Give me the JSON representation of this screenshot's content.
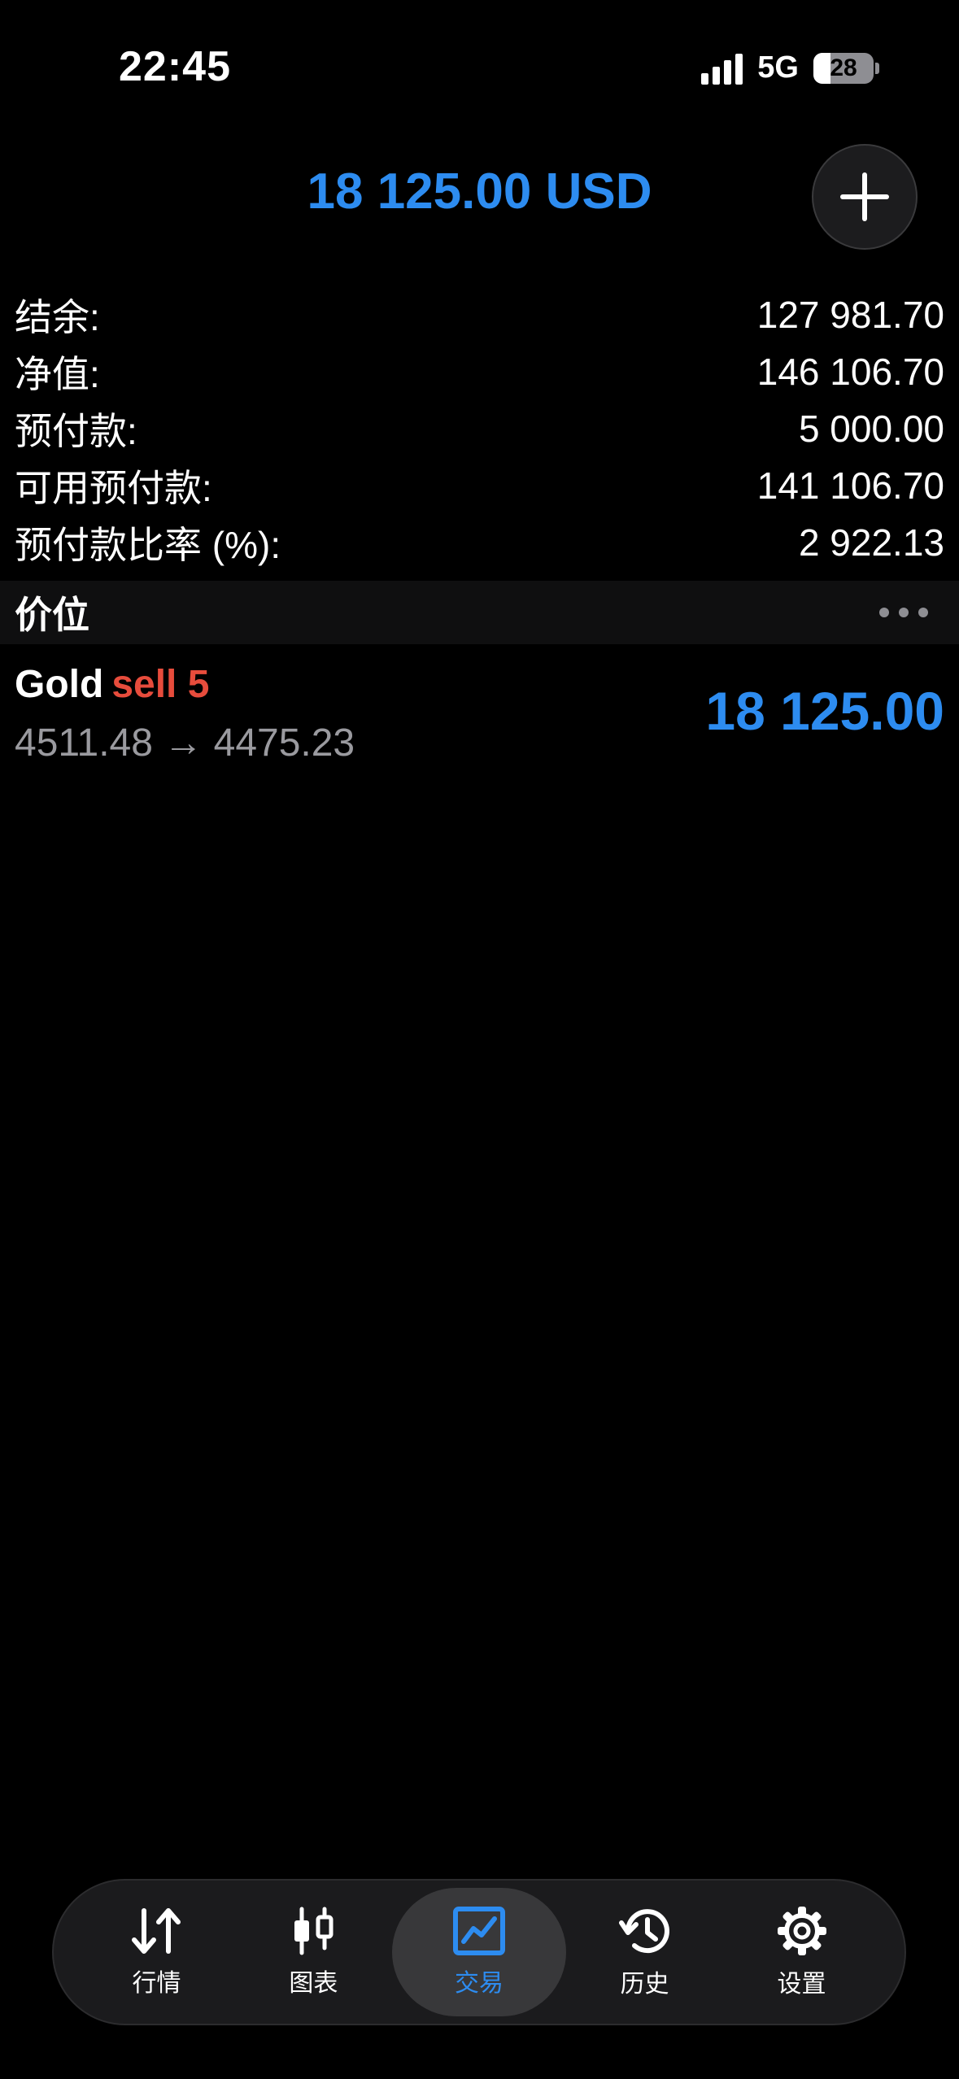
{
  "status_bar": {
    "time": "22:45",
    "network": "5G",
    "battery": "28",
    "battery_level_percent": 28
  },
  "header": {
    "total": "18 125.00 USD",
    "add_icon": "plus-icon"
  },
  "account": {
    "rows": [
      {
        "label": "结余:",
        "value": "127 981.70"
      },
      {
        "label": "净值:",
        "value": "146 106.70"
      },
      {
        "label": "预付款:",
        "value": "5 000.00"
      },
      {
        "label": "可用预付款:",
        "value": "141 106.70"
      },
      {
        "label": "预付款比率 (%):",
        "value": "2 922.13"
      }
    ]
  },
  "section": {
    "title": "价位",
    "more_icon": "more-dots-icon"
  },
  "positions": [
    {
      "symbol": "Gold",
      "side": "sell 5",
      "prices": "4511.48 → 4475.23",
      "profit": "18 125.00"
    }
  ],
  "colors": {
    "accent": "#2d8cf0",
    "sell": "#e74c3c",
    "background": "#000000"
  },
  "nav": {
    "tabs": [
      {
        "label": "行情",
        "icon": "arrows-updown-icon",
        "active": false
      },
      {
        "label": "图表",
        "icon": "candlestick-icon",
        "active": false
      },
      {
        "label": "交易",
        "icon": "trade-chart-icon",
        "active": true
      },
      {
        "label": "历史",
        "icon": "history-icon",
        "active": false
      },
      {
        "label": "设置",
        "icon": "gear-icon",
        "active": false
      }
    ]
  }
}
